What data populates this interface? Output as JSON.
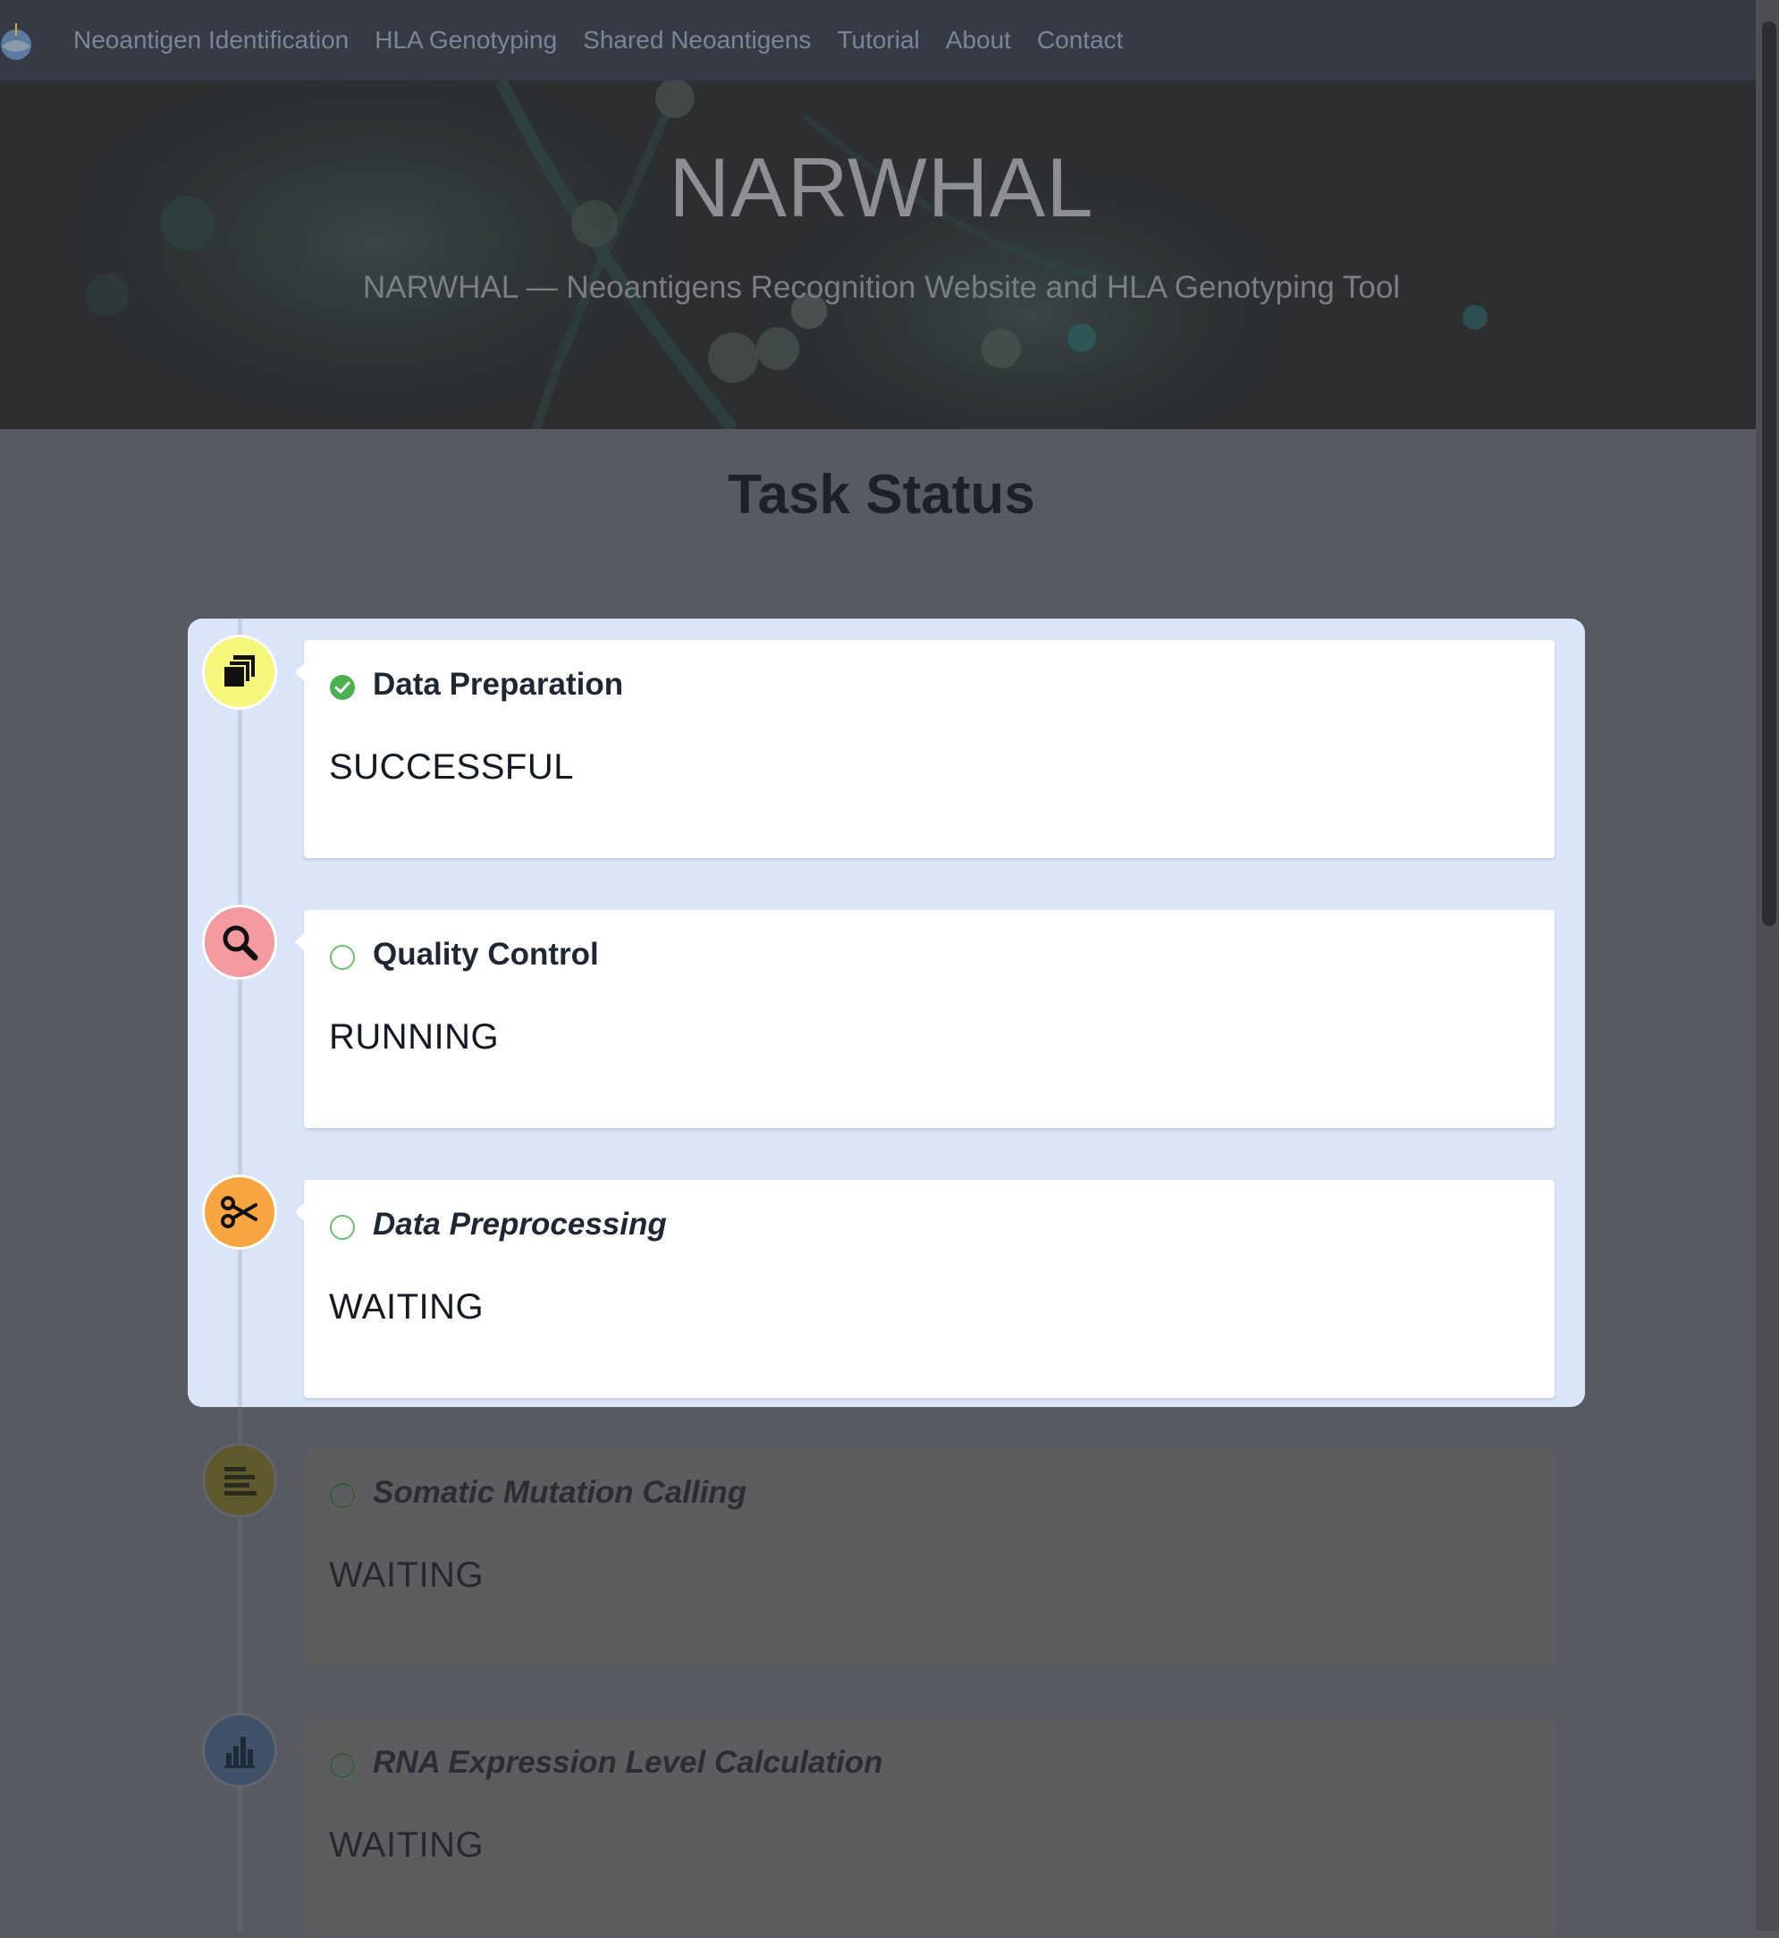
{
  "nav": {
    "items": [
      {
        "label": "Neoantigen Identification"
      },
      {
        "label": "HLA Genotyping"
      },
      {
        "label": "Shared Neoantigens"
      },
      {
        "label": "Tutorial"
      },
      {
        "label": "About"
      },
      {
        "label": "Contact"
      }
    ]
  },
  "hero": {
    "title": "NARWHAL",
    "subtitle": "NARWHAL — Neoantigens Recognition Website and HLA Genotyping Tool"
  },
  "page": {
    "section_title": "Task Status"
  },
  "steps": [
    {
      "title": "Data Preparation",
      "status": "SUCCESSFUL",
      "icon": "copy-icon",
      "complete": true
    },
    {
      "title": "Quality Control",
      "status": "RUNNING",
      "icon": "search-icon",
      "complete": false
    },
    {
      "title": "Data Preprocessing",
      "status": "WAITING",
      "icon": "scissors-icon",
      "complete": false
    },
    {
      "title": "Somatic Mutation Calling",
      "status": "WAITING",
      "icon": "align-left-icon",
      "complete": false
    },
    {
      "title": "RNA Expression Level Calculation",
      "status": "WAITING",
      "icon": "bar-chart-icon",
      "complete": false
    }
  ],
  "colors": {
    "nav_bg": "#353a45",
    "overlay_bg": "#575a63",
    "highlight_bg": "#dbe5f8",
    "success_green": "#4caf50",
    "icon_yellow": "#f4f77a",
    "icon_pink": "#f29a9f",
    "icon_orange": "#f7a541",
    "icon_olive": "#5f5a2c",
    "icon_blue": "#3f526a"
  }
}
